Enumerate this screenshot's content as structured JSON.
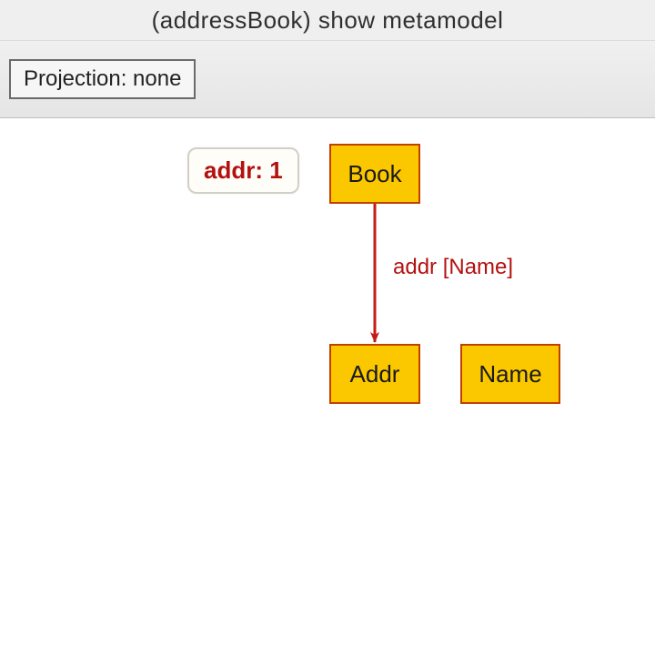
{
  "window": {
    "title": "(addressBook) show metamodel"
  },
  "toolbar": {
    "projection_label": "Projection: none"
  },
  "diagram": {
    "info_bubble": "addr: 1",
    "nodes": {
      "book": "Book",
      "addr": "Addr",
      "name": "Name"
    },
    "edge_label": "addr [Name]",
    "colors": {
      "node_fill": "#fbc800",
      "node_border": "#c04000",
      "edge": "#c61a1a",
      "accent_text": "#b31010"
    }
  }
}
